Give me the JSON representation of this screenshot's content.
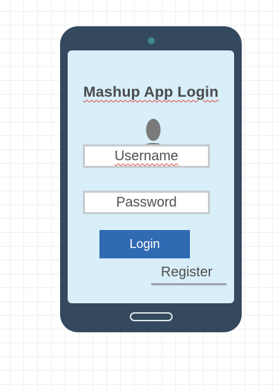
{
  "app": {
    "title": "Mashup App Login"
  },
  "form": {
    "username_placeholder": "Username",
    "password_placeholder": "Password",
    "login_label": "Login",
    "register_label": "Register"
  },
  "icons": {
    "avatar": "user-silhouette-icon",
    "camera": "front-camera",
    "home": "home-button"
  },
  "colors": {
    "device_body": "#34495e",
    "screen_background": "#d8eef9",
    "button_primary": "#2f6ab3",
    "field_border": "#c6cbcf",
    "text": "#4a4a4a",
    "spellcheck_underline": "#e0453a"
  }
}
